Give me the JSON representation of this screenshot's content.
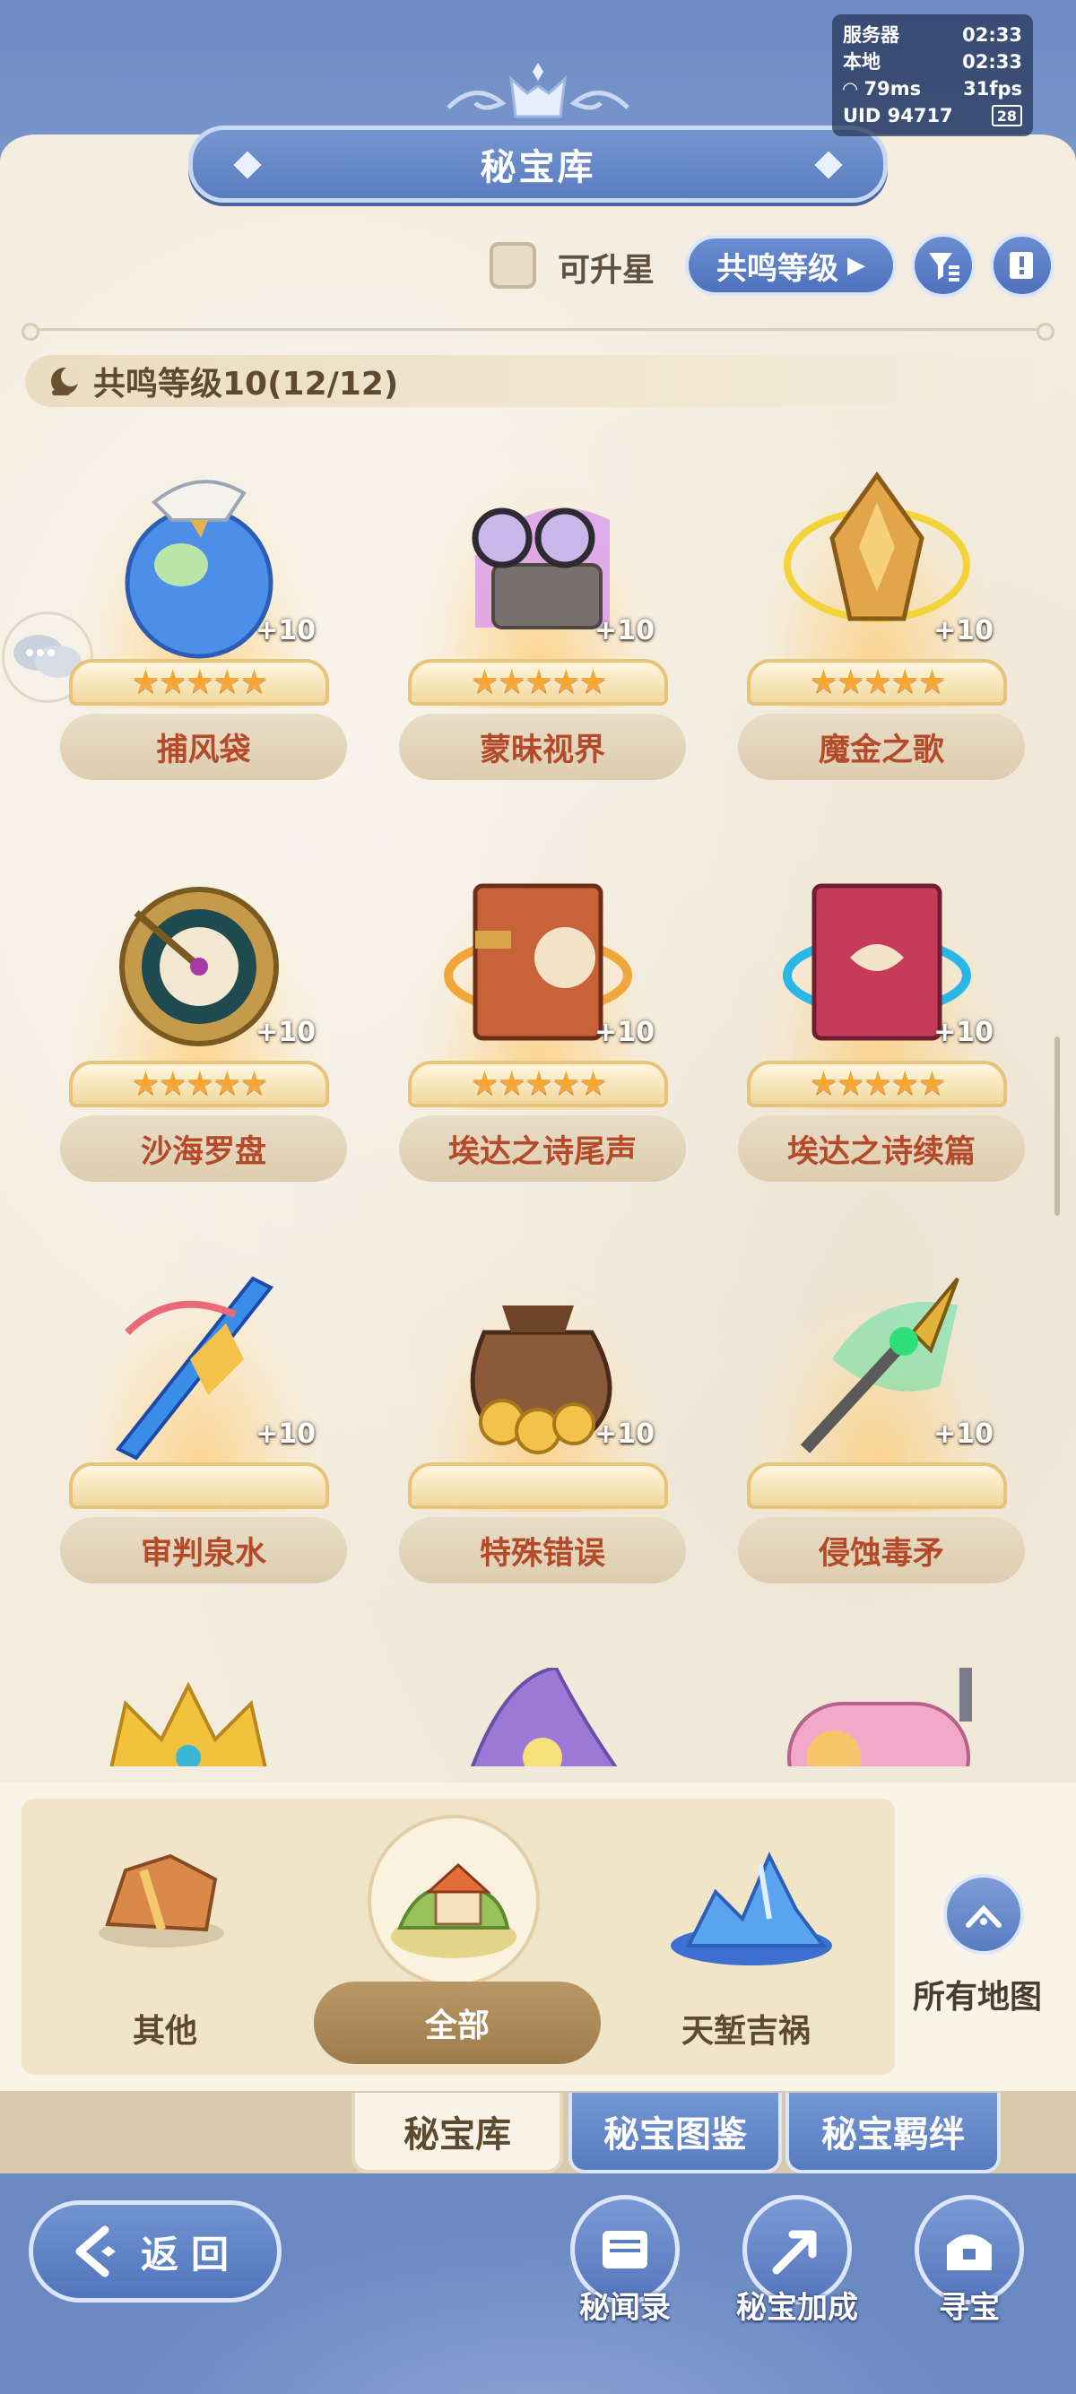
{
  "status": {
    "server_label": "服务器",
    "server_time": "02:33",
    "local_label": "本地",
    "local_time": "02:33",
    "ping": "79ms",
    "fps": "31fps",
    "uid": "UID 94717",
    "battery": "28"
  },
  "header": {
    "title": "秘宝库"
  },
  "filters": {
    "upgradable_label": "可升星",
    "upgradable_checked": false,
    "sort_label": "共鸣等级",
    "filter_icon": "filter-icon",
    "guide_icon": "book-icon"
  },
  "resonance": {
    "label": "共鸣等级10(12/12)"
  },
  "items": [
    {
      "name": "捕风袋",
      "stars": 5,
      "plus": "+10",
      "icon": "wind-bag"
    },
    {
      "name": "蒙昧视界",
      "stars": 5,
      "plus": "+10",
      "icon": "goggles"
    },
    {
      "name": "魔金之歌",
      "stars": 5,
      "plus": "+10",
      "icon": "golden-crystal"
    },
    {
      "name": "沙海罗盘",
      "stars": 5,
      "plus": "+10",
      "icon": "compass"
    },
    {
      "name": "埃达之诗尾声",
      "stars": 5,
      "plus": "+10",
      "icon": "orange-book"
    },
    {
      "name": "埃达之诗续篇",
      "stars": 5,
      "plus": "+10",
      "icon": "red-book"
    },
    {
      "name": "审判泉水",
      "stars": 0,
      "plus": "+10",
      "icon": "crystal-lance"
    },
    {
      "name": "特殊错误",
      "stars": 0,
      "plus": "+10",
      "icon": "coin-bag"
    },
    {
      "name": "侵蚀毒矛",
      "stars": 0,
      "plus": "+10",
      "icon": "poison-spear"
    }
  ],
  "regions": {
    "left": "其他",
    "center": "全部",
    "right": "天堑吉祸",
    "all_maps": "所有地图"
  },
  "tabs": [
    "秘宝库",
    "秘宝图鉴",
    "秘宝羁绊"
  ],
  "bottom": {
    "back": "返回",
    "actions": [
      "秘闻录",
      "秘宝加成",
      "寻宝"
    ]
  },
  "colors": {
    "accent_blue": "#5a7cc0",
    "parchment": "#f3ecdf",
    "item_name": "#b44a2a",
    "star": "#f6a632"
  }
}
